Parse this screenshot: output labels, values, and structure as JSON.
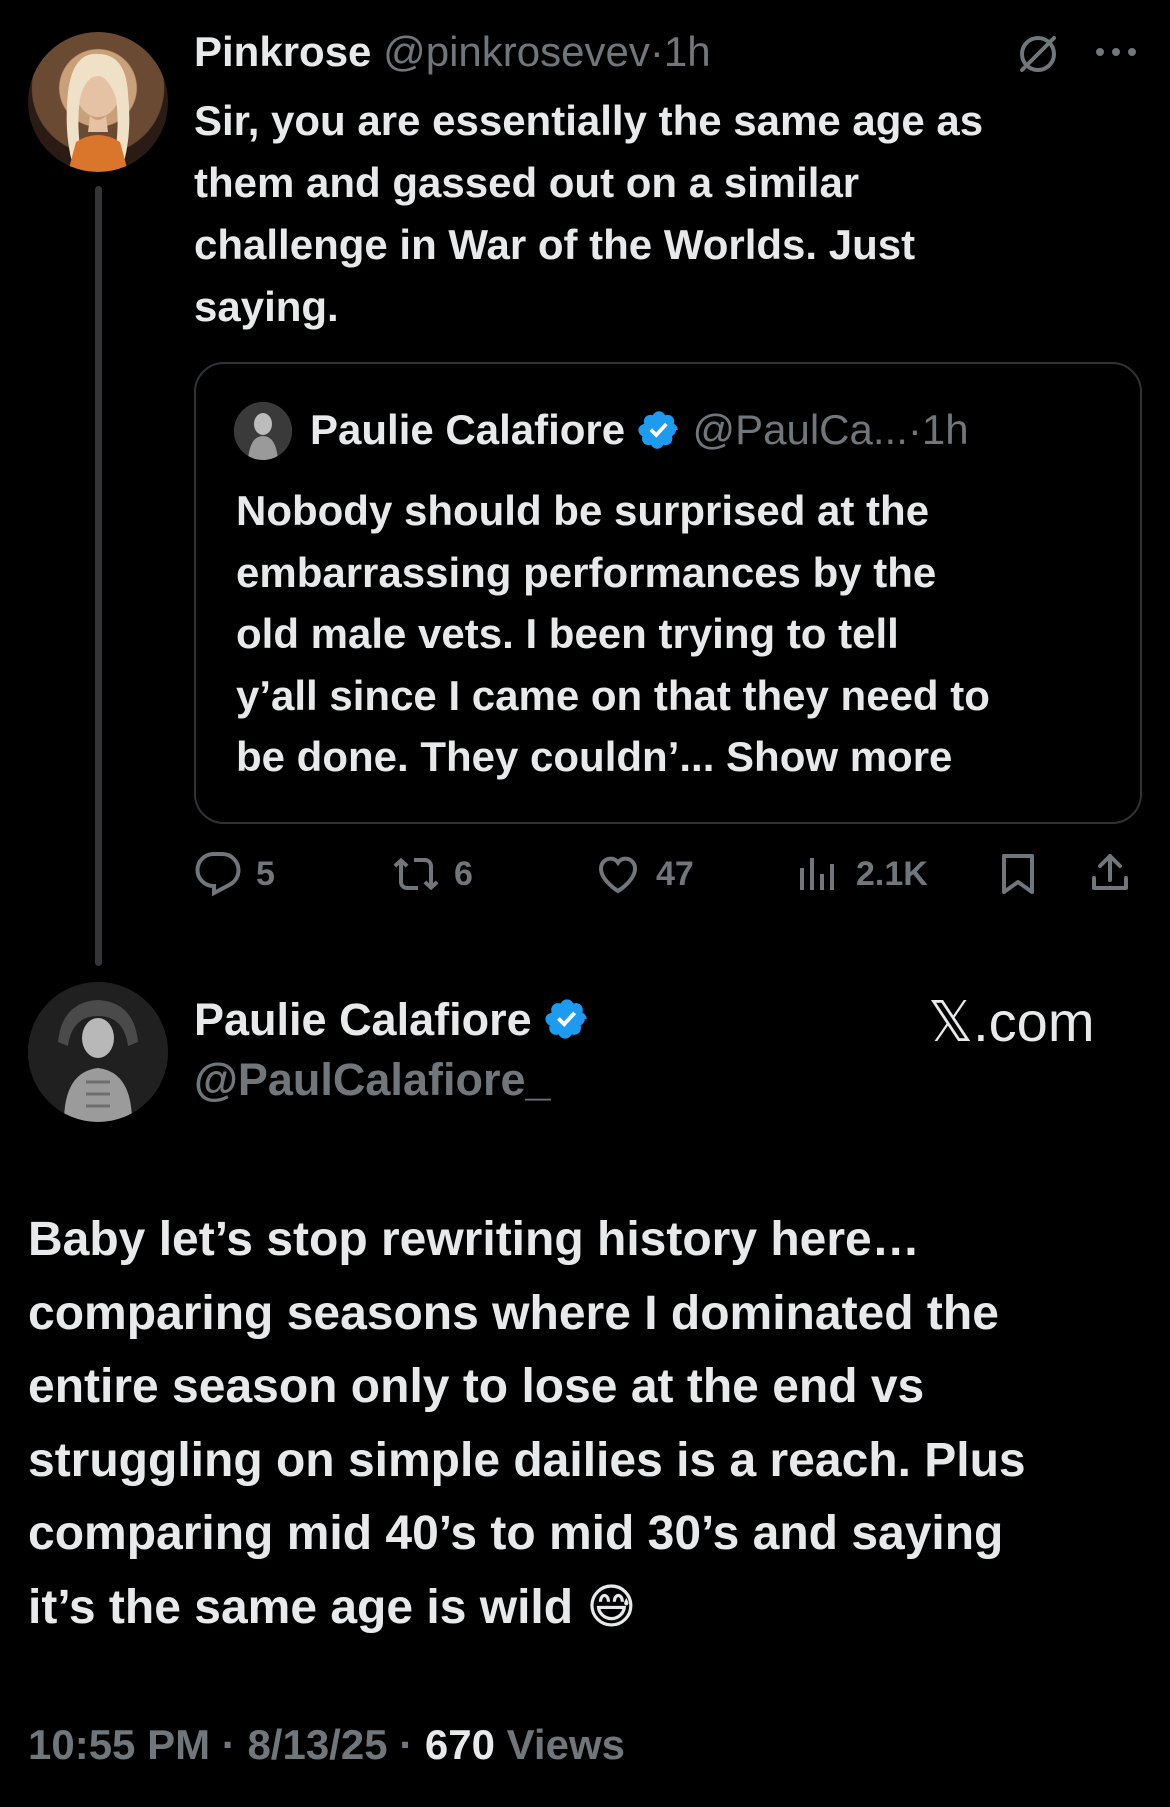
{
  "reply": {
    "display_name": "Pinkrose",
    "handle": "@pinkrosevev",
    "dot": "·",
    "time": "1h",
    "icon_mute": "circle-slash-icon",
    "icon_more": "more-dots-icon",
    "text_lines": [
      "Sir, you are essentially the same age as",
      "them and gassed out on a similar",
      "challenge in War of the Worlds. Just",
      "saying."
    ],
    "quote": {
      "display_name": "Paulie Calafiore",
      "handle": "@PaulCa...",
      "dot": "·",
      "time": "1h",
      "text_lines": [
        "Nobody should be surprised at the",
        "embarrassing performances by the",
        "old male vets. I been trying to tell",
        "y’all since I came on that they need to",
        "be done. They couldn’... Show more"
      ]
    },
    "actions": {
      "replies": "5",
      "reposts": "6",
      "likes": "47",
      "views": "2.1K"
    }
  },
  "main": {
    "display_name": "Paulie Calafiore",
    "handle": "@PaulCalafiore_",
    "brand": "𝕏.com",
    "text_lines": [
      "Baby let’s stop rewriting history here…",
      "comparing seasons where I dominated the",
      "entire season only to lose at the end vs",
      "struggling on simple dailies is a reach. Plus",
      "comparing mid 40’s to mid 30’s and saying",
      "it’s the same age is wild 😅"
    ],
    "timestamp": "10:55 PM",
    "dot": "·",
    "date": "8/13/25",
    "view_count": "670",
    "views_label": "Views"
  },
  "colors": {
    "verified": "#1d9bf0",
    "muted": "#71767b",
    "text": "#e7e9ea",
    "background": "#000000"
  }
}
